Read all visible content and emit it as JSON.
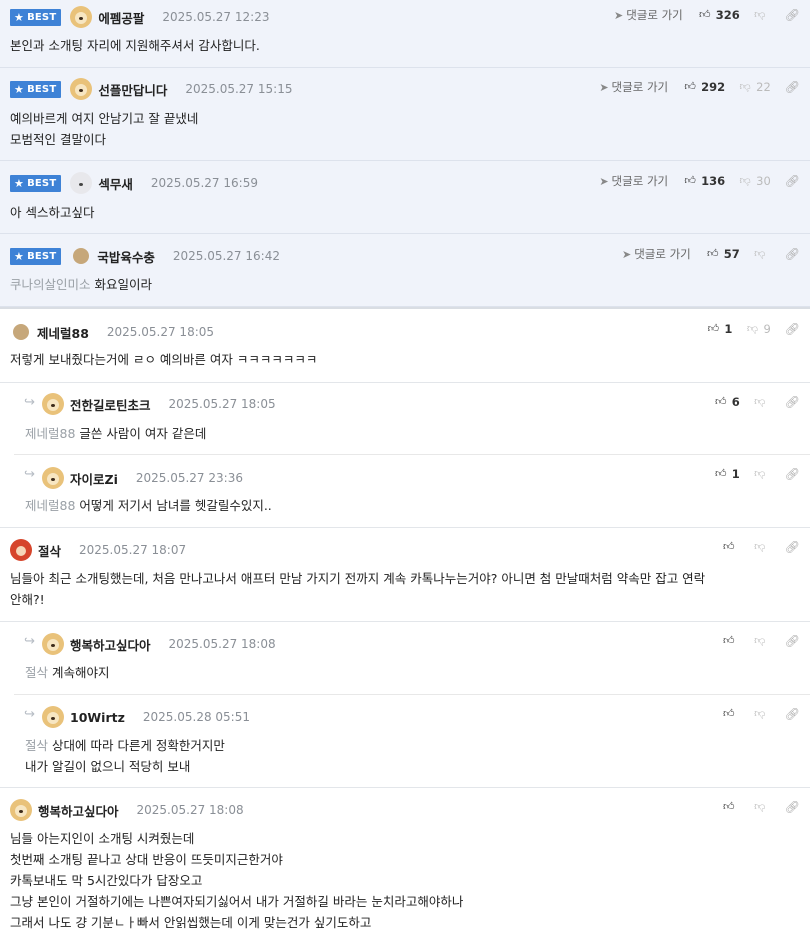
{
  "best_label": "BEST",
  "goto_label": "댓글로 가기",
  "best_comments": [
    {
      "nick": "에펨공팔",
      "date": "2025.05.27 12:23",
      "likes": "326",
      "dislikes": "",
      "avatar": "dog",
      "lines": [
        "본인과 소개팅 자리에 지원해주셔서 감사합니다."
      ],
      "mention": ""
    },
    {
      "nick": "선플만답니다",
      "date": "2025.05.27 15:15",
      "likes": "292",
      "dislikes": "22",
      "avatar": "dog",
      "lines": [
        "예의바르게 여지 안남기고 잘 끝냈네",
        "모범적인 결말이다"
      ],
      "mention": ""
    },
    {
      "nick": "섹무새",
      "date": "2025.05.27 16:59",
      "likes": "136",
      "dislikes": "30",
      "avatar": "white",
      "lines": [
        "아 섹스하고싶다"
      ],
      "mention": ""
    },
    {
      "nick": "국밥육수충",
      "date": "2025.05.27 16:42",
      "likes": "57",
      "dislikes": "",
      "avatar": "ball",
      "lines": [
        "화요일이라"
      ],
      "mention": "쿠나의살인미소"
    }
  ],
  "comments": [
    {
      "nick": "제네럴88",
      "date": "2025.05.27 18:05",
      "likes": "1",
      "dislikes": "9",
      "avatar": "ball",
      "lines": [
        "저렇게 보내줬다는거에 ㄹㅇ 예의바른 여자 ㅋㅋㅋㅋㅋㅋㅋ"
      ],
      "mention": ""
    },
    {
      "nick": "전한길로틴초크",
      "date": "2025.05.27 18:05",
      "likes": "6",
      "dislikes": "",
      "avatar": "dog",
      "lines": [
        "글쓴 사람이 여자 같은데"
      ],
      "mention": "제네럴88"
    },
    {
      "nick": "자이로Zi",
      "date": "2025.05.27 23:36",
      "likes": "1",
      "dislikes": "",
      "avatar": "dog",
      "lines": [
        "어떻게 저기서 남녀를 헷갈릴수있지.."
      ],
      "mention": "제네럴88"
    },
    {
      "nick": "절삭",
      "date": "2025.05.27 18:07",
      "likes": "",
      "dislikes": "",
      "avatar": "red",
      "lines": [
        "님들아 최근 소개팅했는데, 처음 만나고나서 애프터 만남 가지기 전까지 계속 카톡나누는거야? 아니면 첨 만날때처럼 약속만 잡고 연락",
        "안해?!"
      ],
      "mention": ""
    },
    {
      "nick": "행복하고싶다아",
      "date": "2025.05.27 18:08",
      "likes": "",
      "dislikes": "",
      "avatar": "dog",
      "lines": [
        "계속해야지"
      ],
      "mention": "절삭"
    },
    {
      "nick": "10Wirtz",
      "date": "2025.05.28 05:51",
      "likes": "",
      "dislikes": "",
      "avatar": "dog",
      "lines": [
        "상대에 따라 다른게 정확한거지만",
        "내가 알길이 없으니 적당히 보내"
      ],
      "mention": "절삭"
    },
    {
      "nick": "행복하고싶다아",
      "date": "2025.05.27 18:08",
      "likes": "",
      "dislikes": "",
      "avatar": "dog",
      "lines": [
        "님들 아는지인이 소개팅 시켜줬는데",
        "첫번째 소개팅 끝나고 상대 반응이 뜨듯미지근한거야",
        "카톡보내도 막 5시간있다가 답장오고",
        "그냥 본인이 거절하기에는 나쁜여자되기싫어서 내가 거절하길 바라는 눈치라고해야하나",
        "그래서 나도 걍 기분ㄴㅏ빠서 안읽씹했는데 이게 맞는건가 싶기도하고"
      ],
      "mention": ""
    }
  ]
}
